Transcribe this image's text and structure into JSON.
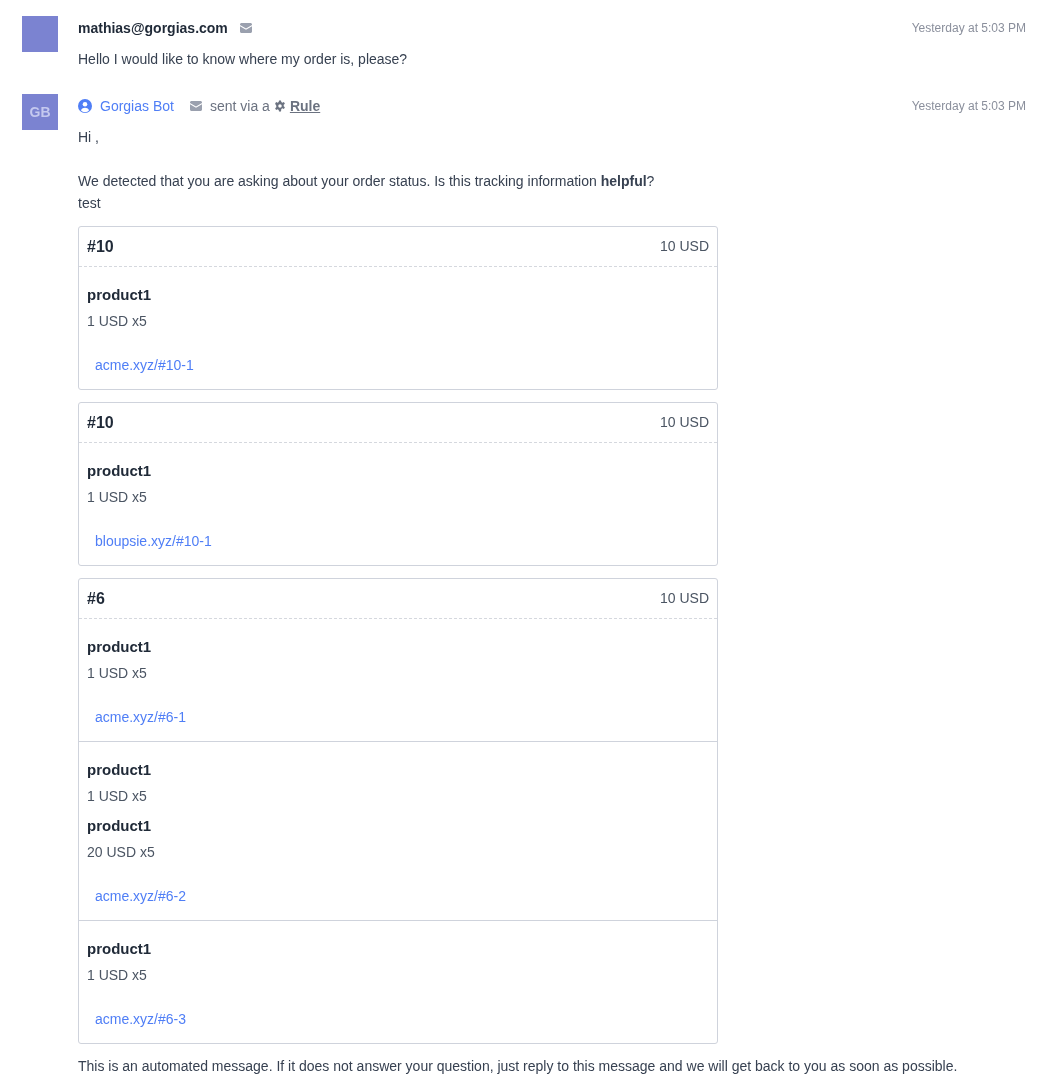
{
  "messages": [
    {
      "avatar": {
        "color": "#7b83d1"
      },
      "sender": "mathias@gorgias.com",
      "kind": "customer",
      "time": "Yesterday at 5:03 PM",
      "body": [
        [
          "Hello I would like to know where my order is, please?"
        ]
      ]
    },
    {
      "avatar": {
        "initials": "GB",
        "color": "#7b83d1"
      },
      "sender": "Gorgias Bot",
      "kind": "bot",
      "via": {
        "prefix": "sent via a",
        "link": "Rule"
      },
      "time": "Yesterday at 5:03 PM",
      "body": [
        [
          "Hi ,"
        ],
        [
          "We detected that you are asking about your order status. Is this tracking information **helpful**?",
          "test"
        ]
      ],
      "orders": [
        {
          "number": "#10",
          "total": "10 USD",
          "fulfillments": [
            {
              "items": [
                {
                  "name": "product1",
                  "price": "1 USD x5"
                }
              ],
              "link": "acme.xyz/#10-1"
            }
          ]
        },
        {
          "number": "#10",
          "total": "10 USD",
          "fulfillments": [
            {
              "items": [
                {
                  "name": "product1",
                  "price": "1 USD x5"
                }
              ],
              "link": "bloupsie.xyz/#10-1"
            }
          ]
        },
        {
          "number": "#6",
          "total": "10 USD",
          "fulfillments": [
            {
              "items": [
                {
                  "name": "product1",
                  "price": "1 USD x5"
                }
              ],
              "link": "acme.xyz/#6-1"
            },
            {
              "items": [
                {
                  "name": "product1",
                  "price": "1 USD x5"
                },
                {
                  "name": "product1",
                  "price": "20 USD x5"
                }
              ],
              "link": "acme.xyz/#6-2"
            },
            {
              "items": [
                {
                  "name": "product1",
                  "price": "1 USD x5"
                }
              ],
              "link": "acme.xyz/#6-3"
            }
          ]
        }
      ],
      "footer": "This is an automated message. If it does not answer your question, just reply to this message and we will get back to you as soon as possible."
    }
  ]
}
